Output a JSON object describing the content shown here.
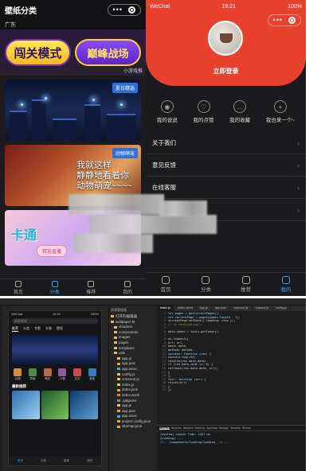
{
  "colors": {
    "accent_red": "#e8412e",
    "accent_blue": "#2ca7ff",
    "tag_blue": "#2f6fd6",
    "dark_bg": "#1c1c1e"
  },
  "wallpaper_page": {
    "title": "壁纸分类",
    "capsule": {
      "dots": "•••",
      "icon": "target-icon"
    },
    "region": "广东",
    "banner": {
      "left_button": "闯关模式",
      "right_button": "巅峰战场",
      "source": "小游戏推"
    },
    "cards": [
      {
        "tag": "夏日精选",
        "kind": "city-night"
      },
      {
        "tag": "动物萌宠",
        "kind": "cat",
        "caption": [
          "我就这样",
          "静静地看着你",
          "动物萌宠~~~~"
        ]
      },
      {
        "tag": "",
        "kind": "pink",
        "caption": [
          "卡通",
          "精选"
        ],
        "pill": "精选直播"
      }
    ],
    "tabbar": [
      {
        "label": "首页",
        "icon": "home-icon",
        "active": false
      },
      {
        "label": "分类",
        "icon": "category-icon",
        "active": true
      },
      {
        "label": "推荐",
        "icon": "recommend-icon",
        "active": false
      },
      {
        "label": "我的",
        "icon": "user-icon",
        "active": false
      }
    ]
  },
  "my_page": {
    "status": {
      "carrier": "WeChat",
      "time": "19:21",
      "battery": "100%"
    },
    "login_label": "立即登录",
    "shortcuts": [
      {
        "label": "我的说说",
        "icon": "eye-icon"
      },
      {
        "label": "我的点赞",
        "icon": "like-icon"
      },
      {
        "label": "我的收藏",
        "icon": "chat-icon"
      },
      {
        "label": "我也来一个~",
        "icon": "more-icon"
      }
    ],
    "rows": [
      {
        "label": "关于我们"
      },
      {
        "label": "意见反馈"
      },
      {
        "label": "在线客服"
      },
      {
        "label": ""
      }
    ],
    "tabbar": [
      {
        "label": "首页",
        "icon": "home-icon",
        "active": false
      },
      {
        "label": "分类",
        "icon": "category-icon",
        "active": false
      },
      {
        "label": "推荐",
        "icon": "recommend-icon",
        "active": false
      },
      {
        "label": "我的",
        "icon": "user-icon",
        "active": true
      }
    ]
  },
  "ide": {
    "simulator": {
      "status": {
        "carrier": "WeChat",
        "time": "19:21",
        "battery": "100%"
      },
      "search_placeholder": "搜索壁纸",
      "tabs": [
        "推荐",
        "分类",
        "专题",
        "头像",
        "壁纸"
      ],
      "icons": [
        "动漫",
        "风景",
        "萌宠",
        "人物",
        "文字",
        "其他"
      ],
      "section": "最新推荐",
      "tabbar": [
        "首页",
        "分类",
        "推荐",
        "我的"
      ]
    },
    "tree": {
      "header": "资源管理器",
      "items": [
        "打开的编辑器",
        "wallpaper-kt",
        "cloudres",
        "components",
        "images",
        "pages",
        "templates",
        "utils",
        "app.js",
        "app.json",
        "app.wxss",
        "config.js",
        "common.js",
        "index.js",
        "index.json",
        "index.wxml",
        ".gitignore",
        "app.js",
        "app.json",
        "app.wxss",
        "project.config.json",
        "sitemap.json"
      ]
    },
    "editor_tabs": [
      "index.js",
      "index.wxml",
      "app.js",
      "app.json",
      "common.js",
      "request.js",
      "config.js"
    ],
    "code": [
      "let pages = getCurrentPages();",
      "let currentPage = pages[pages.length - 1];",
      "currentPage.setData({ loading: true });",
      "// wx.showLoading();",
      "",
      "data.token = tools.getToken();",
      "",
      "wx.request({",
      "  url: url,",
      "  data: data,",
      "  method: method,",
      "  success: function (res) {",
      "    console.log(res)",
      "    resolve(res.data.data)",
      "    if (res.data.code === 0) {",
      "      callback(res.data.data, url);",
      "    }",
      "  },",
      "  fail: function (err) {",
      "    reject(err)",
      "  }",
      "})"
    ],
    "console_tabs": [
      "Console",
      "Sources",
      "Network",
      "Memory",
      "AppData",
      "Storage",
      "Security",
      "Sensor"
    ],
    "console_lines": [
      "[system] Launch Time: 1321 ms",
      "[Loading] ...",
      "<!-- /components/loading/loading --> ..."
    ]
  }
}
